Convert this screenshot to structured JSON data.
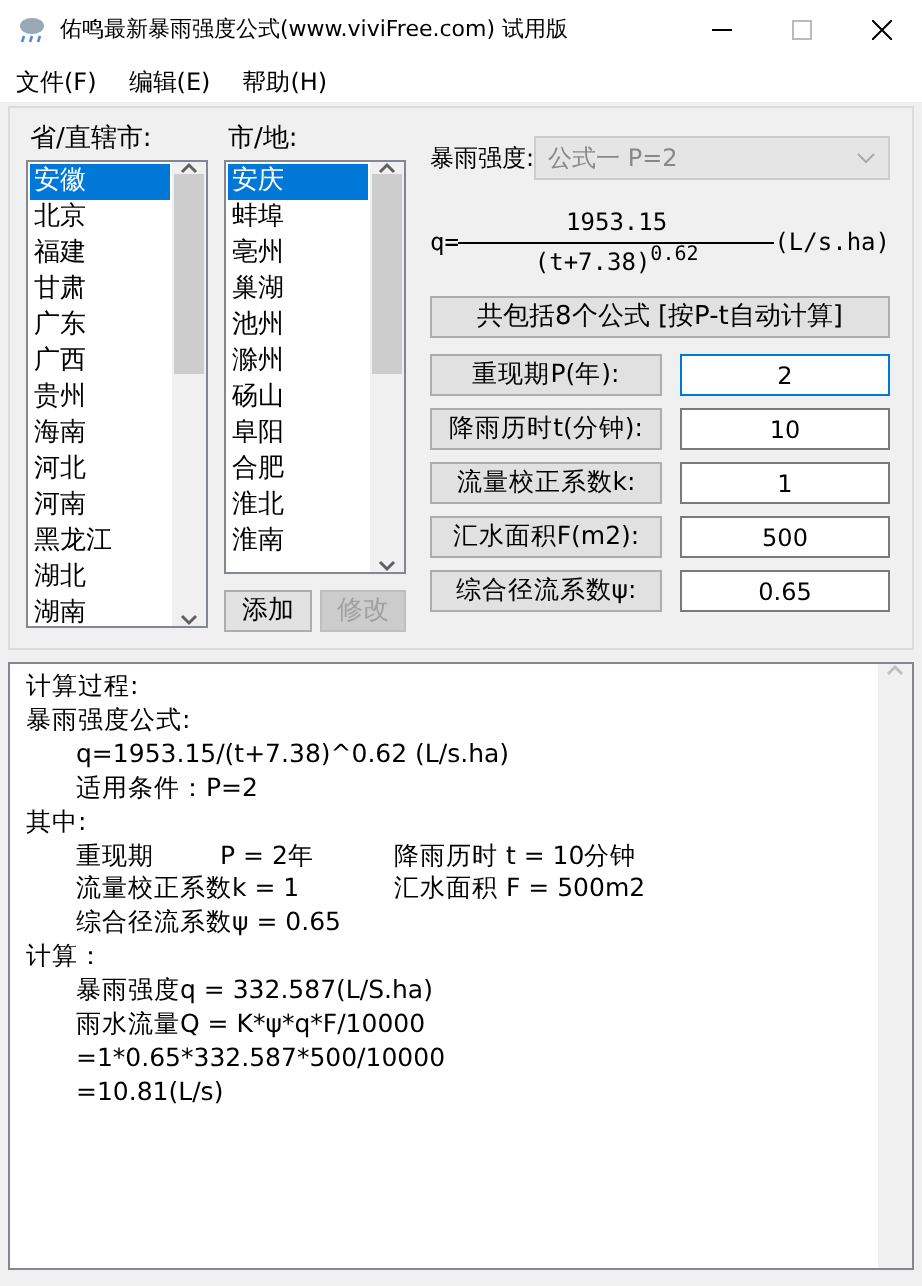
{
  "window": {
    "title": "佑鸣最新暴雨强度公式(www.viviFree.com) 试用版"
  },
  "menu": [
    "文件(F)",
    "编辑(E)",
    "帮助(H)"
  ],
  "provinces": {
    "label": "省/直辖市:",
    "items": [
      {
        "text": "安徽",
        "selected": true
      },
      {
        "text": "北京",
        "selected": false
      },
      {
        "text": "福建",
        "selected": false
      },
      {
        "text": "甘肃",
        "selected": false
      },
      {
        "text": "广东",
        "selected": false
      },
      {
        "text": "广西",
        "selected": false
      },
      {
        "text": "贵州",
        "selected": false
      },
      {
        "text": "海南",
        "selected": false
      },
      {
        "text": "河北",
        "selected": false
      },
      {
        "text": "河南",
        "selected": false
      },
      {
        "text": "黑龙江",
        "selected": false
      },
      {
        "text": "湖北",
        "selected": false
      },
      {
        "text": "湖南",
        "selected": false
      }
    ]
  },
  "cities": {
    "label": "市/地:",
    "items": [
      {
        "text": "安庆",
        "selected": true
      },
      {
        "text": "蚌埠",
        "selected": false
      },
      {
        "text": "亳州",
        "selected": false
      },
      {
        "text": "巢湖",
        "selected": false
      },
      {
        "text": "池州",
        "selected": false
      },
      {
        "text": "滁州",
        "selected": false
      },
      {
        "text": "砀山",
        "selected": false
      },
      {
        "text": "阜阳",
        "selected": false
      },
      {
        "text": "合肥",
        "selected": false
      },
      {
        "text": "淮北",
        "selected": false
      },
      {
        "text": "淮南",
        "selected": false
      }
    ]
  },
  "city_buttons": [
    {
      "label": "添加",
      "disabled": false
    },
    {
      "label": "修改",
      "disabled": true
    }
  ],
  "formula_select": {
    "label": "暴雨强度:",
    "value": "公式一 P=2",
    "disabled": true
  },
  "formula": {
    "lhs": "q=",
    "numerator": "1953.15",
    "base": "(t+7.38)",
    "exponent": "0.62",
    "unit": "(L/s.ha)"
  },
  "auto_button": "共包括8个公式 [按P-t自动计算]",
  "params": [
    {
      "label": "重现期P(年):",
      "value": "2",
      "focused": true
    },
    {
      "label": "降雨历时t(分钟):",
      "value": "10",
      "focused": false
    },
    {
      "label": "流量校正系数k:",
      "value": "1",
      "focused": false
    },
    {
      "label": "汇水面积F(m2):",
      "value": "500",
      "focused": false
    },
    {
      "label": "综合径流系数ψ:",
      "value": "0.65",
      "focused": false
    }
  ],
  "result": [
    {
      "heading": "计算过程:"
    },
    {
      "heading": "暴雨强度公式:",
      "lines": [
        {
          "cells": [
            "q=1953.15/(t+7.38)^0.62 (L/s.ha)"
          ]
        },
        {
          "cells": [
            "适用条件：P=2"
          ]
        }
      ]
    },
    {
      "heading": "其中:",
      "lines": [
        {
          "cells": [
            "重现期",
            "P = 2年",
            "降雨历时 t = 10分钟"
          ]
        },
        {
          "cells": [
            "流量校正系数k = 1",
            "汇水面积 F = 500m2"
          ]
        },
        {
          "cells": [
            "综合径流系数ψ = 0.65"
          ]
        }
      ]
    },
    {
      "heading": "计算：",
      "lines": [
        {
          "cells": [
            "暴雨强度q = 332.587(L/S.ha)"
          ]
        },
        {
          "cells": [
            "雨水流量Q = K*ψ*q*F/10000"
          ]
        },
        {
          "cells": [
            "=1*0.65*332.587*500/10000"
          ]
        },
        {
          "cells": [
            "=10.81(L/s)"
          ]
        }
      ]
    }
  ]
}
